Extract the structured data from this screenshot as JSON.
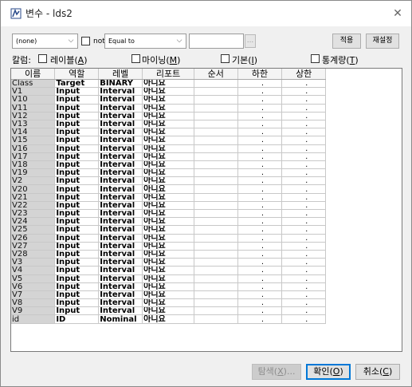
{
  "window": {
    "title": "변수 - lds2",
    "app_icon": "sas-miner-icon",
    "close_glyph": "✕"
  },
  "filter": {
    "column_select": "(none)",
    "not_label": "not",
    "operator_select": "Equal to",
    "value": "",
    "ellipsis_label": "...",
    "apply_label": "적용",
    "reset_label": "재설정"
  },
  "columns_bar": {
    "label": "칼럼:",
    "options": [
      {
        "text": "레이블(",
        "key": "A",
        "end": ")",
        "checked": false
      },
      {
        "text": "마이닝(",
        "key": "M",
        "end": ")",
        "checked": false
      },
      {
        "text": "기본(",
        "key": "I",
        "end": ")",
        "checked": false
      },
      {
        "text": "통계량(",
        "key": "T",
        "end": ")",
        "checked": false
      }
    ]
  },
  "table": {
    "headers": [
      "이름",
      "역할",
      "레벨",
      "리포트",
      "순서",
      "하한",
      "상한"
    ],
    "rows": [
      [
        "Class",
        "Target",
        "BINARY",
        "아니요",
        "",
        ".",
        "."
      ],
      [
        "V1",
        "Input",
        "Interval",
        "아니요",
        "",
        ".",
        "."
      ],
      [
        "V10",
        "Input",
        "Interval",
        "아니요",
        "",
        ".",
        "."
      ],
      [
        "V11",
        "Input",
        "Interval",
        "아니요",
        "",
        ".",
        "."
      ],
      [
        "V12",
        "Input",
        "Interval",
        "아니요",
        "",
        ".",
        "."
      ],
      [
        "V13",
        "Input",
        "Interval",
        "아니요",
        "",
        ".",
        "."
      ],
      [
        "V14",
        "Input",
        "Interval",
        "아니요",
        "",
        ".",
        "."
      ],
      [
        "V15",
        "Input",
        "Interval",
        "아니요",
        "",
        ".",
        "."
      ],
      [
        "V16",
        "Input",
        "Interval",
        "아니요",
        "",
        ".",
        "."
      ],
      [
        "V17",
        "Input",
        "Interval",
        "아니요",
        "",
        ".",
        "."
      ],
      [
        "V18",
        "Input",
        "Interval",
        "아니요",
        "",
        ".",
        "."
      ],
      [
        "V19",
        "Input",
        "Interval",
        "아니요",
        "",
        ".",
        "."
      ],
      [
        "V2",
        "Input",
        "Interval",
        "아니요",
        "",
        ".",
        "."
      ],
      [
        "V20",
        "Input",
        "Interval",
        "아니요",
        "",
        ".",
        "."
      ],
      [
        "V21",
        "Input",
        "Interval",
        "아니요",
        "",
        ".",
        "."
      ],
      [
        "V22",
        "Input",
        "Interval",
        "아니요",
        "",
        ".",
        "."
      ],
      [
        "V23",
        "Input",
        "Interval",
        "아니요",
        "",
        ".",
        "."
      ],
      [
        "V24",
        "Input",
        "Interval",
        "아니요",
        "",
        ".",
        "."
      ],
      [
        "V25",
        "Input",
        "Interval",
        "아니요",
        "",
        ".",
        "."
      ],
      [
        "V26",
        "Input",
        "Interval",
        "아니요",
        "",
        ".",
        "."
      ],
      [
        "V27",
        "Input",
        "Interval",
        "아니요",
        "",
        ".",
        "."
      ],
      [
        "V28",
        "Input",
        "Interval",
        "아니요",
        "",
        ".",
        "."
      ],
      [
        "V3",
        "Input",
        "Interval",
        "아니요",
        "",
        ".",
        "."
      ],
      [
        "V4",
        "Input",
        "Interval",
        "아니요",
        "",
        ".",
        "."
      ],
      [
        "V5",
        "Input",
        "Interval",
        "아니요",
        "",
        ".",
        "."
      ],
      [
        "V6",
        "Input",
        "Interval",
        "아니요",
        "",
        ".",
        "."
      ],
      [
        "V7",
        "Input",
        "Interval",
        "아니요",
        "",
        ".",
        "."
      ],
      [
        "V8",
        "Input",
        "Interval",
        "아니요",
        "",
        ".",
        "."
      ],
      [
        "V9",
        "Input",
        "Interval",
        "아니요",
        "",
        ".",
        "."
      ],
      [
        "id",
        "ID",
        "Nominal",
        "아니요",
        "",
        ".",
        "."
      ]
    ]
  },
  "buttons": {
    "explore": {
      "text": "탐색(",
      "key": "X",
      "end": ")...",
      "enabled": false
    },
    "ok": {
      "text": "확인(",
      "key": "O",
      "end": ")"
    },
    "cancel": {
      "text": "취소(",
      "key": "C",
      "end": ")"
    }
  },
  "colors": {
    "focus": "#0078d7",
    "name_cell_bg": "#d4d4d4",
    "dialog_bg": "#f0f0f0"
  }
}
